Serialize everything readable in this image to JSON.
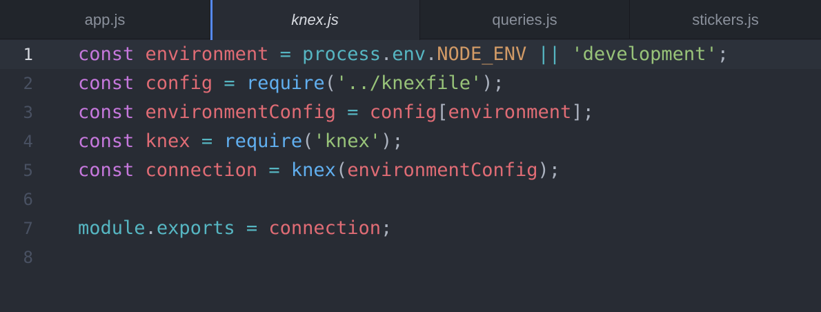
{
  "tabs": [
    {
      "label": "app.js",
      "active": false
    },
    {
      "label": "knex.js",
      "active": true
    },
    {
      "label": "queries.js",
      "active": false
    },
    {
      "label": "stickers.js",
      "active": false
    }
  ],
  "editor": {
    "cursor_line": 1,
    "lines": [
      {
        "num": "1",
        "tokens": [
          [
            "const",
            "kw"
          ],
          [
            " ",
            ""
          ],
          [
            "environment",
            "var"
          ],
          [
            " ",
            ""
          ],
          [
            "=",
            "op"
          ],
          [
            " ",
            ""
          ],
          [
            "process",
            "mod"
          ],
          [
            ".",
            "punc"
          ],
          [
            "env",
            "mod"
          ],
          [
            ".",
            "punc"
          ],
          [
            "NODE_ENV",
            "const"
          ],
          [
            " ",
            ""
          ],
          [
            "||",
            "op"
          ],
          [
            " ",
            ""
          ],
          [
            "'development'",
            "str"
          ],
          [
            ";",
            "punc"
          ]
        ]
      },
      {
        "num": "2",
        "tokens": [
          [
            "const",
            "kw"
          ],
          [
            " ",
            ""
          ],
          [
            "config",
            "var"
          ],
          [
            " ",
            ""
          ],
          [
            "=",
            "op"
          ],
          [
            " ",
            ""
          ],
          [
            "require",
            "fn"
          ],
          [
            "(",
            "punc"
          ],
          [
            "'../knexfile'",
            "str"
          ],
          [
            ");",
            "punc"
          ]
        ]
      },
      {
        "num": "3",
        "tokens": [
          [
            "const",
            "kw"
          ],
          [
            " ",
            ""
          ],
          [
            "environmentConfig",
            "var"
          ],
          [
            " ",
            ""
          ],
          [
            "=",
            "op"
          ],
          [
            " ",
            ""
          ],
          [
            "config",
            "var"
          ],
          [
            "[",
            "punc"
          ],
          [
            "environment",
            "var"
          ],
          [
            "];",
            "punc"
          ]
        ]
      },
      {
        "num": "4",
        "tokens": [
          [
            "const",
            "kw"
          ],
          [
            " ",
            ""
          ],
          [
            "knex",
            "var"
          ],
          [
            " ",
            ""
          ],
          [
            "=",
            "op"
          ],
          [
            " ",
            ""
          ],
          [
            "require",
            "fn"
          ],
          [
            "(",
            "punc"
          ],
          [
            "'knex'",
            "str"
          ],
          [
            ");",
            "punc"
          ]
        ]
      },
      {
        "num": "5",
        "tokens": [
          [
            "const",
            "kw"
          ],
          [
            " ",
            ""
          ],
          [
            "connection",
            "var"
          ],
          [
            " ",
            ""
          ],
          [
            "=",
            "op"
          ],
          [
            " ",
            ""
          ],
          [
            "knex",
            "fn"
          ],
          [
            "(",
            "punc"
          ],
          [
            "environmentConfig",
            "var"
          ],
          [
            ");",
            "punc"
          ]
        ]
      },
      {
        "num": "6",
        "tokens": []
      },
      {
        "num": "7",
        "tokens": [
          [
            "module",
            "mod"
          ],
          [
            ".",
            "punc"
          ],
          [
            "exports",
            "mod"
          ],
          [
            " ",
            ""
          ],
          [
            "=",
            "op"
          ],
          [
            " ",
            ""
          ],
          [
            "connection",
            "var"
          ],
          [
            ";",
            "punc"
          ]
        ]
      },
      {
        "num": "8",
        "tokens": []
      }
    ]
  }
}
